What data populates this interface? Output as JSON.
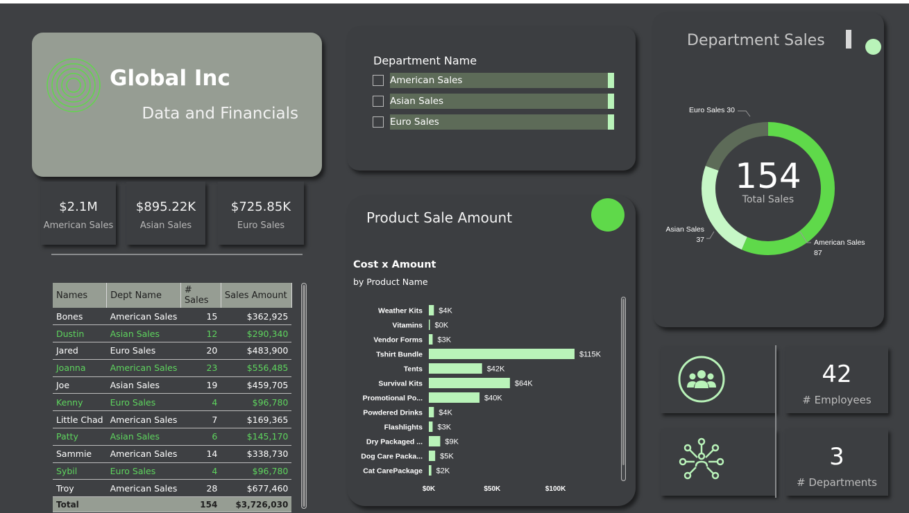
{
  "colors": {
    "background": "#3e4043",
    "accent_green": "#5fd94a",
    "light_green": "#b9f3b9",
    "sage": "#969d93",
    "dark_sage": "#5d6b58"
  },
  "header": {
    "company_name": "Global Inc",
    "subtitle": "Data and Financials",
    "logo_icon": "concentric-circles-icon"
  },
  "kpis": [
    {
      "value": "$2.1M",
      "label": "American Sales"
    },
    {
      "value": "$895.22K",
      "label": "Asian Sales"
    },
    {
      "value": "$725.85K",
      "label": "Euro Sales"
    }
  ],
  "table": {
    "columns": [
      "Names",
      "Dept Name",
      "# Sales",
      "Sales Amount"
    ],
    "rows": [
      [
        "Bones",
        "American Sales",
        "15",
        "$362,925"
      ],
      [
        "Dustin",
        "Asian Sales",
        "12",
        "$290,340"
      ],
      [
        "Jared",
        "Euro Sales",
        "20",
        "$483,900"
      ],
      [
        "Joanna",
        "American Sales",
        "23",
        "$556,485"
      ],
      [
        "Joe",
        "Asian Sales",
        "19",
        "$459,705"
      ],
      [
        "Kenny",
        "Euro Sales",
        "4",
        "$96,780"
      ],
      [
        "Little Chad",
        "American Sales",
        "7",
        "$169,365"
      ],
      [
        "Patty",
        "Asian Sales",
        "6",
        "$145,170"
      ],
      [
        "Sammie",
        "American Sales",
        "14",
        "$338,730"
      ],
      [
        "Sybil",
        "Euro Sales",
        "4",
        "$96,780"
      ],
      [
        "Troy",
        "American Sales",
        "28",
        "$677,460"
      ]
    ],
    "total": [
      "Total",
      "",
      "154",
      "$3,726,030"
    ]
  },
  "slicer": {
    "title": "Department Name",
    "items": [
      "American Sales",
      "Asian Sales",
      "Euro Sales"
    ]
  },
  "product_card": {
    "title": "Product Sale Amount"
  },
  "chart_data": [
    {
      "type": "bar",
      "title": "Cost x Amount",
      "subtitle": "by Product Name",
      "orientation": "horizontal",
      "categories": [
        "Weather Kits",
        "Vitamins",
        "Vendor Forms",
        "Tshirt Bundle",
        "Tents",
        "Survival Kits",
        "Promotional Po...",
        "Powdered Drinks",
        "Flashlights",
        "Dry Packaged ...",
        "Dog Care Packa...",
        "Cat CarePackage"
      ],
      "values": [
        4,
        0,
        3,
        115,
        42,
        64,
        40,
        4,
        3,
        9,
        5,
        2
      ],
      "data_labels": [
        "$4K",
        "$0K",
        "$3K",
        "$115K",
        "$42K",
        "$64K",
        "$40K",
        "$4K",
        "$3K",
        "$9K",
        "$5K",
        "$2K"
      ],
      "x_ticks": [
        "$0K",
        "$50K",
        "$100K"
      ],
      "xlim": [
        0,
        115
      ],
      "color": "#b9f3b9"
    },
    {
      "type": "pie",
      "variant": "donut",
      "title": "Department Sales",
      "center_value": "154",
      "center_label": "Total Sales",
      "slices": [
        {
          "name": "American Sales",
          "value": 87,
          "color": "#5fd94a"
        },
        {
          "name": "Asian Sales",
          "value": 37,
          "color": "#c6f7c6"
        },
        {
          "name": "Euro Sales",
          "value": 30,
          "color": "#5d6b58"
        }
      ]
    }
  ],
  "stats": {
    "employees": {
      "value": "42",
      "label": "# Employees",
      "icon": "people-group-icon"
    },
    "departments": {
      "value": "3",
      "label": "# Departments",
      "icon": "network-nodes-icon"
    }
  }
}
